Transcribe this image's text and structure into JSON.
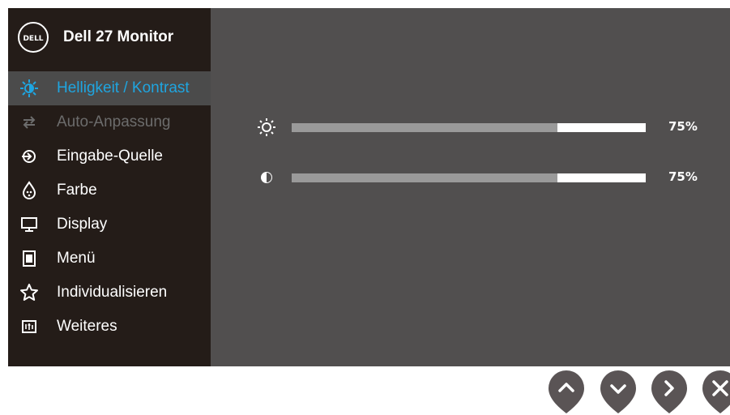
{
  "header": {
    "title": "Dell 27 Monitor",
    "logo_text": "DELL"
  },
  "menu": {
    "items": [
      {
        "label": "Helligkeit / Kontrast",
        "icon": "brightness-icon",
        "state": "selected"
      },
      {
        "label": "Auto-Anpassung",
        "icon": "auto-adjust-icon",
        "state": "disabled"
      },
      {
        "label": "Eingabe-Quelle",
        "icon": "input-source-icon",
        "state": "normal"
      },
      {
        "label": "Farbe",
        "icon": "color-icon",
        "state": "normal"
      },
      {
        "label": "Display",
        "icon": "display-icon",
        "state": "normal"
      },
      {
        "label": "Menü",
        "icon": "menu-icon",
        "state": "normal"
      },
      {
        "label": "Individualisieren",
        "icon": "star-icon",
        "state": "normal"
      },
      {
        "label": "Weiteres",
        "icon": "others-icon",
        "state": "normal"
      }
    ]
  },
  "sliders": {
    "brightness": {
      "value": 75,
      "label": "75%",
      "icon": "sun-icon"
    },
    "contrast": {
      "value": 75,
      "label": "75%",
      "icon": "contrast-icon"
    }
  },
  "buttons": [
    "up-button",
    "down-button",
    "next-button",
    "exit-button"
  ],
  "colors": {
    "osd_bg": "#514f4f",
    "sidebar_bg": "#241c18",
    "accent": "#1fa5e0",
    "button": "#5a5455"
  }
}
